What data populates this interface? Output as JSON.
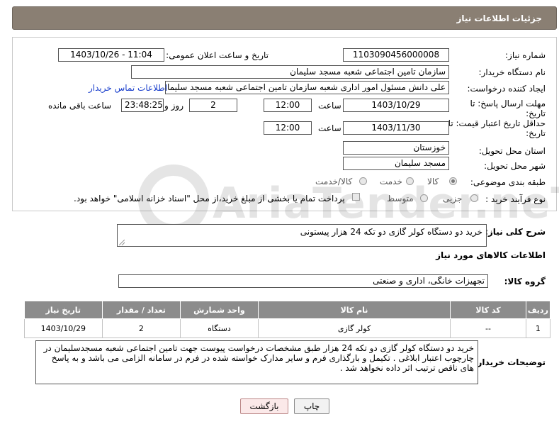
{
  "header": {
    "title": "جزئیات اطلاعات نیاز"
  },
  "form": {
    "need_number_label": "شماره نیاز:",
    "need_number_value": "1103090456000008",
    "announce_label": "تاریخ و ساعت اعلان عمومی:",
    "announce_value": "1403/10/26 - 11:04",
    "buyer_org_label": "نام دستگاه خریدار:",
    "buyer_org_value": "سازمان تامین اجتماعی شعبه مسجد سلیمان",
    "creator_label": "ایجاد کننده درخواست:",
    "creator_value": "علی دانش مسئول امور اداری شعبه سازمان تامین اجتماعی شعبه مسجد سلیمان",
    "contact_link": "اطلاعات تماس خریدار",
    "deadline_label_1": "مهلت ارسال پاسخ: تا",
    "deadline_label_2": "تاریخ:",
    "deadline_date": "1403/10/29",
    "time_label": "ساعت",
    "deadline_time": "12:00",
    "days_value": "2",
    "days_label": "روز و",
    "remaining_value": "23:48:25",
    "remaining_label": "ساعت باقی مانده",
    "validity_label_1": "حداقل تاریخ اعتبار قیمت: تا",
    "validity_label_2": "تاریخ:",
    "validity_date": "1403/11/30",
    "validity_time_label": "ساعت",
    "validity_time": "12:00",
    "province_label": "استان محل تحویل:",
    "province_value": "خوزستان",
    "city_label": "شهر محل تحویل:",
    "city_value": "مسجد سلیمان",
    "category_label": "طبقه بندی موضوعی:",
    "category_options": [
      "کالا",
      "خدمت",
      "کالا/خدمت"
    ],
    "category_selected": "کالا",
    "process_label": "نوع فرآیند خرید :",
    "process_options": [
      "جزیی",
      "متوسط"
    ],
    "payment_text": "پرداخت تمام یا بخشی از مبلغ خرید،از محل \"اسناد خزانه اسلامی\" خواهد بود."
  },
  "summary": {
    "label": "شرح کلی نیاز:",
    "value": "خرید دو دستگاه کولر گازی دو تکه 24 هزار پیستونی"
  },
  "goods": {
    "section_title": "اطلاعات کالاهای مورد نیاز",
    "group_label": "گروه کالا:",
    "group_value": "تجهیزات خانگی، اداری و صنعتی",
    "columns": [
      "ردیف",
      "کد کالا",
      "نام کالا",
      "واحد شمارش",
      "تعداد / مقدار",
      "تاریخ نیاز"
    ],
    "rows": [
      [
        "1",
        "--",
        "کولر گازی",
        "دستگاه",
        "2",
        "1403/10/29"
      ]
    ]
  },
  "buyer_notes": {
    "label": "توضیحات خریدار:",
    "value": "خرید دو دستگاه کولر گازی دو تکه 24 هزار طبق مشخصات درخواست پیوست جهت تامین اجتماعی شعبه مسجدسلیمان در چارچوب اعتبار ابلاغی . تکیمل و بارگذاری فرم و سایر مدارک خواسته شده در فرم  در سامانه الزامی می باشد و به پاسخ های ناقص ترتیب اثر داده نخواهد شد ."
  },
  "buttons": {
    "print": "چاپ",
    "back": "بازگشت"
  },
  "watermark": "AriaTender.neT"
}
